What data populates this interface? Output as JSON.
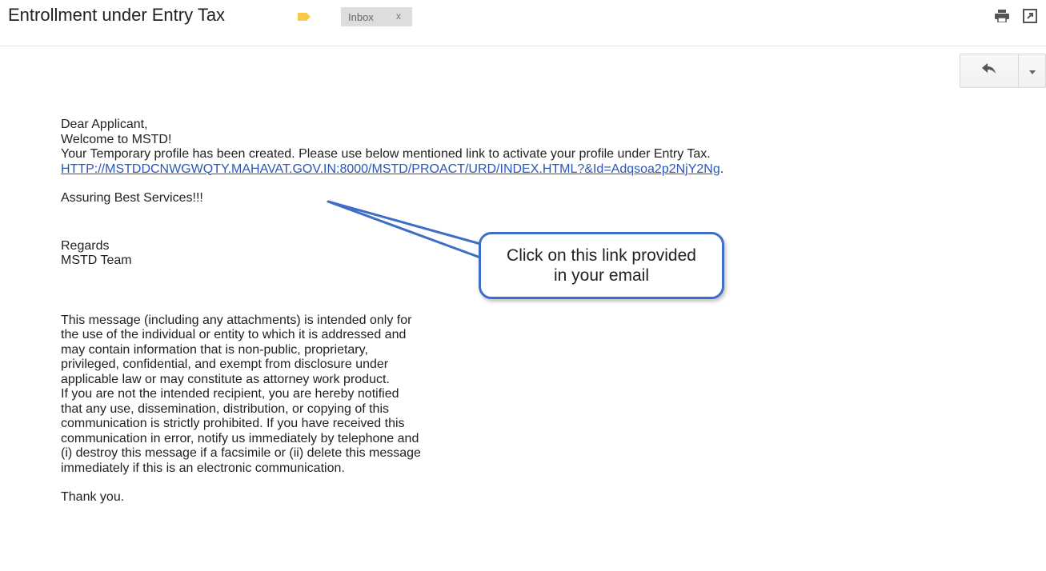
{
  "header": {
    "subject": "Entrollment under Entry Tax",
    "label_chip": "Inbox",
    "label_chip_close": "x",
    "label_color": "#f7c948",
    "icons": [
      "label-tag-icon",
      "print-icon",
      "new-window-icon"
    ]
  },
  "actions": {
    "reply_icon": "reply-icon",
    "more_icon": "caret-down-icon"
  },
  "email": {
    "greeting": "Dear Applicant,",
    "welcome": "Welcome to MSTD!",
    "intro": "Your Temporary profile has been created. Please use below mentioned link to activate your profile under Entry Tax.",
    "link": "HTTP://MSTDDCNWGWQTY.MAHAVAT.GOV.IN:8000/MSTD/PROACT/URD/INDEX.HTML?&Id=Adqsoa2p2NjY2Ng",
    "link_suffix": ".",
    "assurance": "Assuring Best Services!!!",
    "regards": "Regards",
    "team": "MSTD Team",
    "disclaimer_lines": [
      "This message (including any attachments) is intended only for",
      "the use of the individual or entity to which it is addressed and",
      "may contain information that is non-public, proprietary,",
      "privileged, confidential, and exempt from disclosure under",
      "applicable law or may constitute as attorney work product.",
      "If you are not the intended recipient, you are hereby notified",
      "that any use, dissemination, distribution, or copying of this",
      "communication is strictly prohibited. If you have received this",
      "communication in error, notify us immediately by telephone and",
      "(i) destroy this message if a facsimile or (ii) delete this message",
      "immediately if this is an electronic communication."
    ],
    "thanks": "Thank you."
  },
  "callout": {
    "line1": "Click on this link provided",
    "line2": "in your email",
    "border_color": "#3f6fc4"
  },
  "colors": {
    "link": "#2a56b8",
    "text": "#222222"
  }
}
